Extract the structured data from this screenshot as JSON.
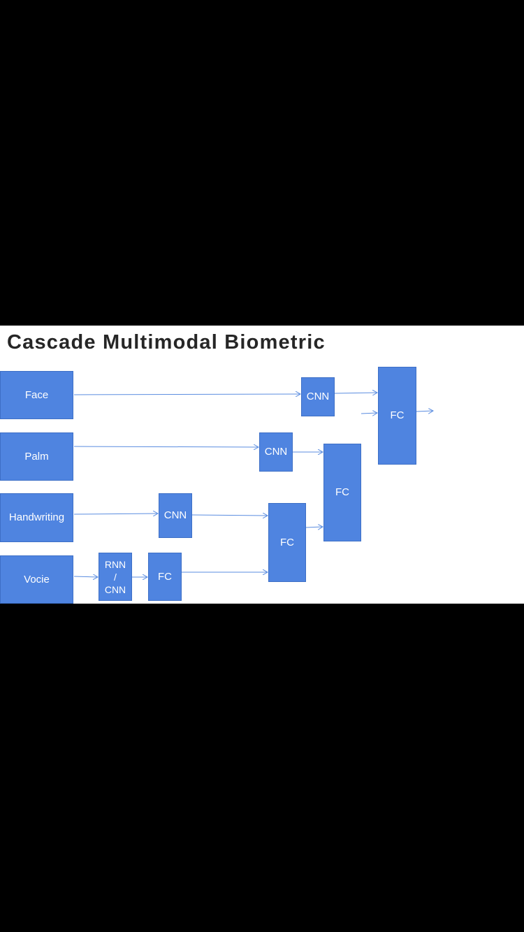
{
  "diagram": {
    "title": "Cascade Multimodal Biometric",
    "accent_color": "#4f84e0",
    "line_color": "#5b8de0",
    "inputs": {
      "face": "Face",
      "palm": "Palm",
      "handwriting": "Handwriting",
      "voice": "Vocie"
    },
    "nodes": {
      "face_cnn": "CNN",
      "palm_cnn": "CNN",
      "handwriting_cnn": "CNN",
      "voice_rnn_cnn": "RNN\n/\nCNN",
      "voice_fc": "FC",
      "fc_level1": "FC",
      "fc_level2": "FC",
      "fc_final": "FC"
    }
  }
}
